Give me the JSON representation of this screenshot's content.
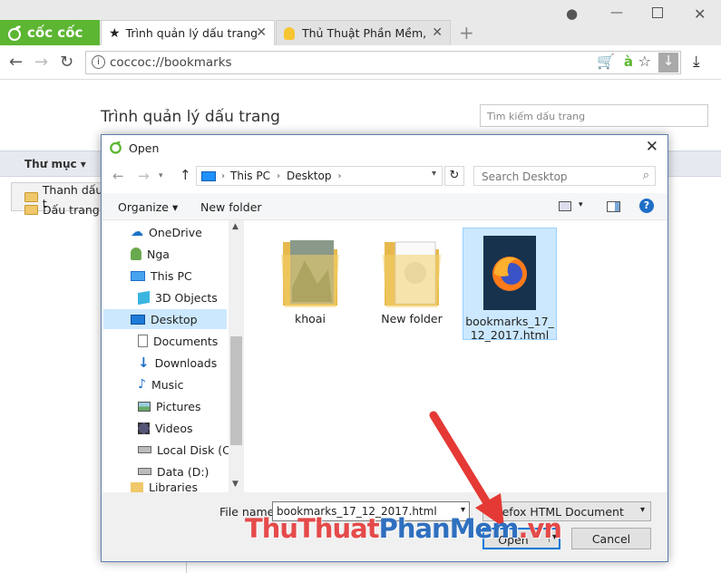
{
  "browser": {
    "logo": "cốc cốc",
    "tabs": [
      {
        "label": "Trình quản lý dấu trang",
        "active": true
      },
      {
        "label": "Thủ Thuật Phần Mềm, Má",
        "active": false
      }
    ],
    "url": "coccoc://bookmarks"
  },
  "bookmarks_page": {
    "title": "Trình quản lý dấu trang",
    "search_placeholder": "Tìm kiếm dấu trang",
    "folder_header": "Thư mục",
    "folders": [
      "Thanh dấu t",
      "Dấu trang k"
    ]
  },
  "dialog": {
    "title": "Open",
    "breadcrumb": [
      "This PC",
      "Desktop"
    ],
    "search_placeholder": "Search Desktop",
    "organize_label": "Organize",
    "new_folder_label": "New folder",
    "nav_items": [
      {
        "label": "OneDrive",
        "icon": "cloud-icon"
      },
      {
        "label": "Nga",
        "icon": "user-icon"
      },
      {
        "label": "This PC",
        "icon": "computer-icon"
      },
      {
        "label": "3D Objects",
        "icon": "cube-icon"
      },
      {
        "label": "Desktop",
        "icon": "desktop-icon",
        "selected": true
      },
      {
        "label": "Documents",
        "icon": "document-icon"
      },
      {
        "label": "Downloads",
        "icon": "download-icon"
      },
      {
        "label": "Music",
        "icon": "music-icon"
      },
      {
        "label": "Pictures",
        "icon": "picture-icon"
      },
      {
        "label": "Videos",
        "icon": "video-icon"
      },
      {
        "label": "Local Disk (C:)",
        "icon": "drive-icon"
      },
      {
        "label": "Data (D:)",
        "icon": "drive-icon"
      },
      {
        "label": "Libraries",
        "icon": "library-icon"
      }
    ],
    "files": [
      {
        "label": "khoai",
        "type": "folder"
      },
      {
        "label": "New folder",
        "type": "folder"
      },
      {
        "label": "bookmarks_17_12_2017.html",
        "type": "firefox-html",
        "selected": true
      }
    ],
    "file_name_label": "File name:",
    "file_name_value": "bookmarks_17_12_2017.html",
    "file_type_value": "Firefox HTML Document",
    "open_label": "Open",
    "cancel_label": "Cancel"
  },
  "watermark": {
    "part1": "ThuThuat",
    "part2": "PhanMem",
    "part3": ".vn"
  },
  "colors": {
    "brand_green": "#5cb632",
    "accent_blue": "#0078d7",
    "selection": "#cce8ff",
    "arrow_red": "#e53935"
  }
}
